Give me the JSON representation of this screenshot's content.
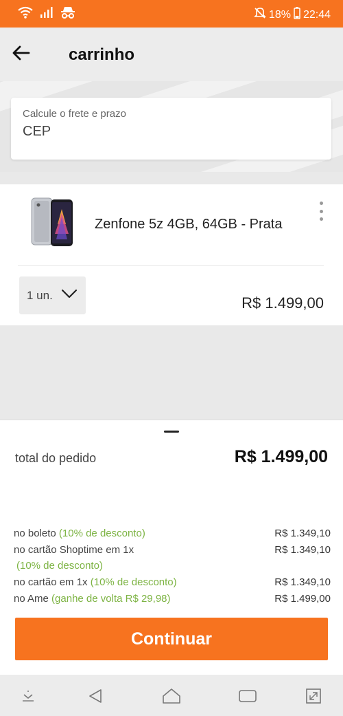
{
  "status_bar": {
    "battery_percent": "18%",
    "time": "22:44",
    "icons": [
      "wifi-icon",
      "signal-icon",
      "incognito-icon",
      "mute-icon",
      "battery-icon"
    ]
  },
  "header": {
    "title": "carrinho",
    "back_icon": "arrow-left-icon"
  },
  "shipping": {
    "label": "Calcule o frete e prazo",
    "placeholder": "CEP"
  },
  "cart_item": {
    "name": "Zenfone 5z 4GB, 64GB - Prata",
    "quantity": "1 un.",
    "price": "R$ 1.499,00",
    "menu_icon": "more-vertical-icon"
  },
  "summary": {
    "total_label": "total do pedido",
    "total_value": "R$ 1.499,00",
    "payments": [
      {
        "label": "no boleto",
        "note": "(10% de desconto)",
        "amount": "R$ 1.349,10"
      },
      {
        "label": "no cartão Shoptime em 1x",
        "note": "(10% de desconto)",
        "amount": "R$ 1.349,10"
      },
      {
        "label": "no cartão em 1x",
        "note": "(10% de desconto)",
        "amount": "R$ 1.349,10"
      },
      {
        "label": "no Ame",
        "note": "(ganhe de volta R$ 29,98)",
        "amount": "R$ 1.499,00"
      }
    ],
    "continue_label": "Continuar"
  },
  "colors": {
    "accent": "#f7731f",
    "discount": "#7cb342"
  },
  "nav_bar": {
    "icons": [
      "keyboard-hide-icon",
      "back-triangle-icon",
      "home-icon",
      "recents-icon",
      "rotate-screen-icon"
    ]
  }
}
